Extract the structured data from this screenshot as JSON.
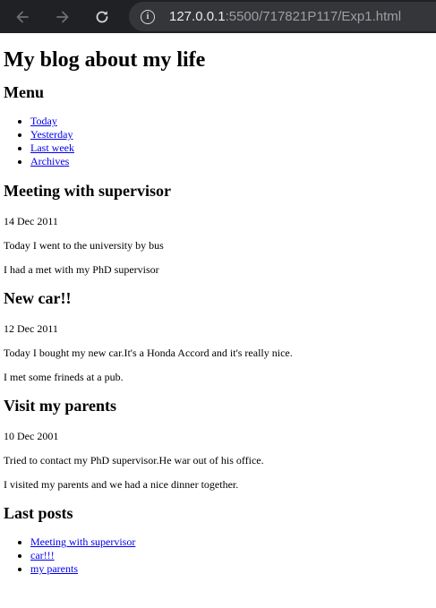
{
  "browser": {
    "url_host": "127.0.0.1",
    "url_rest": ":5500/717821P117/Exp1.html"
  },
  "page": {
    "title": "My blog about my life",
    "menu": {
      "heading": "Menu",
      "items": [
        "Today",
        "Yesterday",
        "Last week",
        "Archives"
      ]
    },
    "posts": [
      {
        "title": "Meeting with supervisor",
        "date": "14 Dec 2011",
        "paragraphs": [
          "Today I went to the university by bus",
          "I had a met with my PhD supervisor"
        ]
      },
      {
        "title": "New car!!",
        "date": "12 Dec 2011",
        "paragraphs": [
          "Today I bought my new car.It's a Honda Accord and it's really nice.",
          "I met some frineds at a pub."
        ]
      },
      {
        "title": "Visit my parents",
        "date": "10 Dec 2001",
        "paragraphs": [
          "Tried to contact my PhD supervisor.He war out of his office.",
          "I visited my parents and we had a nice dinner together."
        ]
      }
    ],
    "last_posts": {
      "heading": "Last posts",
      "items": [
        "Meeting with supervisor",
        "car!!!",
        "my parents"
      ]
    }
  }
}
